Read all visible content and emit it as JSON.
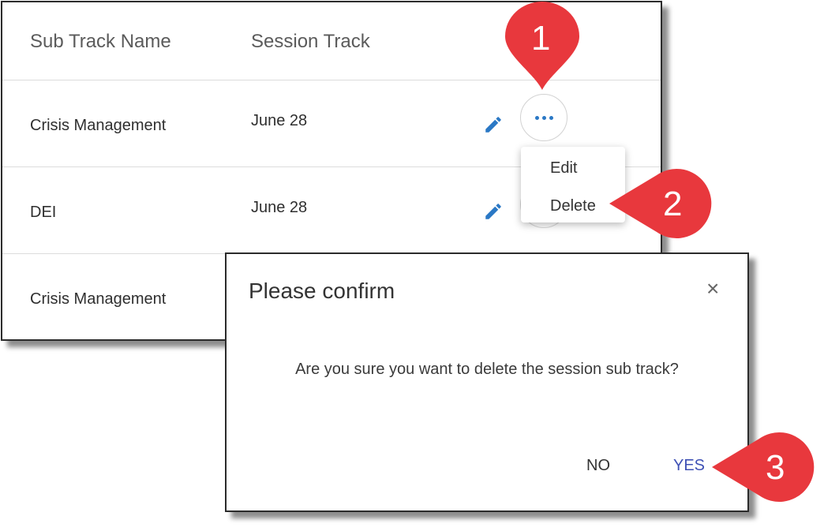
{
  "table": {
    "headers": {
      "name": "Sub Track Name",
      "track": "Session Track"
    },
    "rows": [
      {
        "name": "Crisis Management",
        "track": "June 28"
      },
      {
        "name": "DEI",
        "track": "June 28"
      },
      {
        "name": "Crisis Management",
        "track": ""
      }
    ],
    "more_button_icon": "more-horizontal-icon",
    "edit_icon": "pencil-icon"
  },
  "menu": {
    "items": [
      "Edit",
      "Delete"
    ]
  },
  "dialog": {
    "title": "Please confirm",
    "close_glyph": "×",
    "message": "Are you sure you want to delete the session sub track?",
    "no_label": "NO",
    "yes_label": "YES"
  },
  "callouts": [
    "1",
    "2",
    "3"
  ],
  "colors": {
    "accent": "#2a78c5",
    "callout": "#e8383d",
    "yes": "#3f51b5"
  }
}
